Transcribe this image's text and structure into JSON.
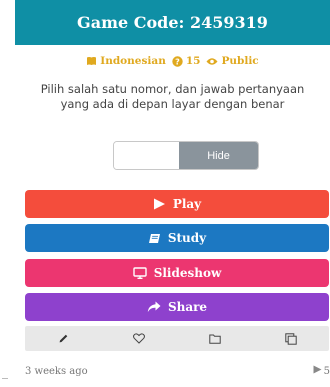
{
  "header": {
    "title": "Game Code: 2459319"
  },
  "meta": {
    "language": "Indonesian",
    "question_count": "15",
    "visibility": "Public",
    "accent_color": "#e0a91f",
    "icons": [
      "book-icon",
      "question-icon",
      "eye-icon"
    ]
  },
  "description": "Pilih salah satu nomor, dan jawab pertanyaan yang ada di depan layar dengan benar",
  "hide_control": {
    "input_value": "",
    "button_label": "Hide"
  },
  "actions": {
    "play": {
      "label": "Play",
      "icon": "play-icon",
      "color": "#f44d3c"
    },
    "study": {
      "label": "Study",
      "icon": "book-icon",
      "color": "#1c78c2"
    },
    "slideshow": {
      "label": "Slideshow",
      "icon": "monitor-icon",
      "color": "#ec3670"
    },
    "share": {
      "label": "Share",
      "icon": "share-icon",
      "color": "#8e41cd"
    }
  },
  "toolbar": {
    "icons": [
      "pencil-icon",
      "heart-icon",
      "folder-icon",
      "copy-icon"
    ]
  },
  "footer": {
    "time_ago": "3 weeks ago",
    "plays": "5"
  },
  "colors": {
    "header_bg": "#0f8fa5",
    "toolbar_bg": "#e8e8e8"
  }
}
